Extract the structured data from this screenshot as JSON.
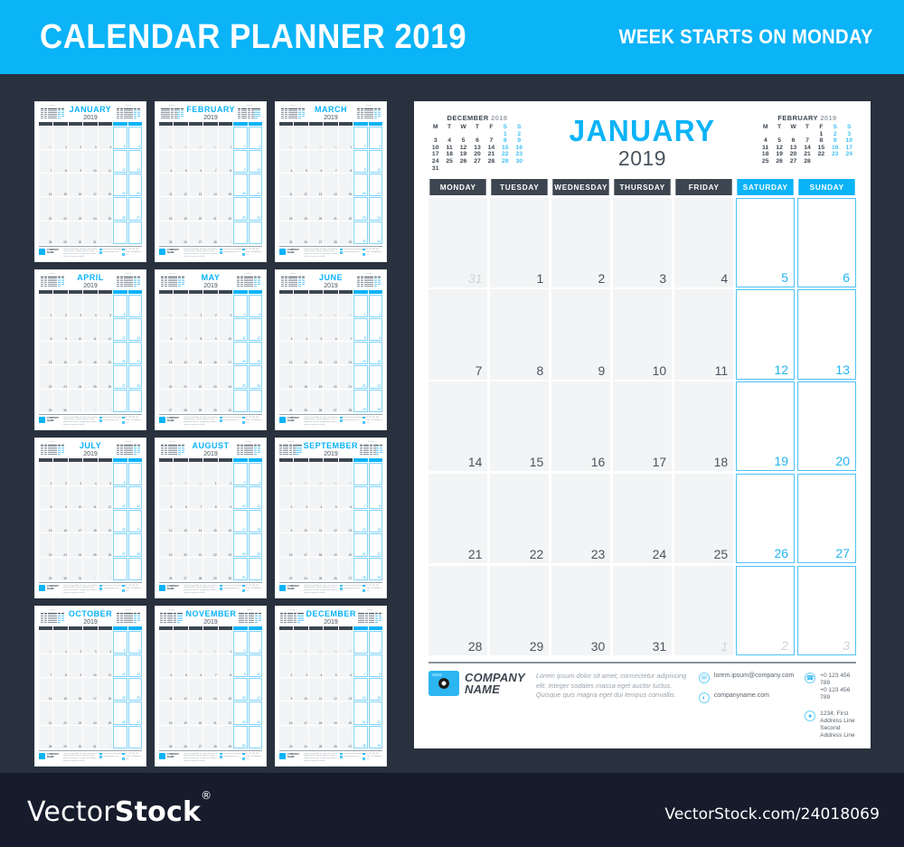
{
  "banner": {
    "title": "CALENDAR PLANNER 2019",
    "subtitle": "WEEK STARTS ON MONDAY"
  },
  "accent_colors": {
    "brand_blue": "#0bb3f7",
    "weekend_blue": "#4fc3f7",
    "dark_slate": "#3d4650",
    "artboard_dark": "#28313d",
    "watermark_bar": "#171c2c",
    "cell_gray": "#f3f4f5",
    "muted_text": "#9aa3ab"
  },
  "main_calendar": {
    "month": "JANUARY",
    "year": "2019",
    "weekday_headers": [
      {
        "label": "MONDAY",
        "weekend": false
      },
      {
        "label": "TUESDAY",
        "weekend": false
      },
      {
        "label": "WEDNESDAY",
        "weekend": false
      },
      {
        "label": "THURSDAY",
        "weekend": false
      },
      {
        "label": "FRIDAY",
        "weekend": false
      },
      {
        "label": "SATURDAY",
        "weekend": true
      },
      {
        "label": "SUNDAY",
        "weekend": true
      }
    ],
    "weeks": [
      [
        {
          "n": "31",
          "out": true
        },
        {
          "n": "1"
        },
        {
          "n": "2"
        },
        {
          "n": "3"
        },
        {
          "n": "4"
        },
        {
          "n": "5"
        },
        {
          "n": "6"
        }
      ],
      [
        {
          "n": "7"
        },
        {
          "n": "8"
        },
        {
          "n": "9"
        },
        {
          "n": "10"
        },
        {
          "n": "11"
        },
        {
          "n": "12"
        },
        {
          "n": "13"
        }
      ],
      [
        {
          "n": "14"
        },
        {
          "n": "15"
        },
        {
          "n": "16"
        },
        {
          "n": "17"
        },
        {
          "n": "18"
        },
        {
          "n": "19"
        },
        {
          "n": "20"
        }
      ],
      [
        {
          "n": "21"
        },
        {
          "n": "22"
        },
        {
          "n": "23"
        },
        {
          "n": "24"
        },
        {
          "n": "25"
        },
        {
          "n": "26"
        },
        {
          "n": "27"
        }
      ],
      [
        {
          "n": "28"
        },
        {
          "n": "29"
        },
        {
          "n": "30"
        },
        {
          "n": "31"
        },
        {
          "n": "1",
          "out": true
        },
        {
          "n": "2",
          "out": true
        },
        {
          "n": "3",
          "out": true
        }
      ]
    ],
    "prev_mini": {
      "month": "DECEMBER",
      "year": "2018",
      "weekday_initials": [
        "M",
        "T",
        "W",
        "T",
        "F",
        "S",
        "S"
      ],
      "weeks": [
        [
          "",
          "",
          "",
          "",
          "",
          "1",
          "2"
        ],
        [
          "3",
          "4",
          "5",
          "6",
          "7",
          "8",
          "9"
        ],
        [
          "10",
          "11",
          "12",
          "13",
          "14",
          "15",
          "16"
        ],
        [
          "17",
          "18",
          "19",
          "20",
          "21",
          "22",
          "23"
        ],
        [
          "24",
          "25",
          "26",
          "27",
          "28",
          "29",
          "30"
        ],
        [
          "31",
          "",
          "",
          "",
          "",
          "",
          ""
        ]
      ]
    },
    "next_mini": {
      "month": "FEBRUARY",
      "year": "2019",
      "weekday_initials": [
        "M",
        "T",
        "W",
        "T",
        "F",
        "S",
        "S"
      ],
      "weeks": [
        [
          "",
          "",
          "",
          "",
          "1",
          "2",
          "3"
        ],
        [
          "4",
          "5",
          "6",
          "7",
          "8",
          "9",
          "10"
        ],
        [
          "11",
          "12",
          "13",
          "14",
          "15",
          "16",
          "17"
        ],
        [
          "18",
          "19",
          "20",
          "21",
          "22",
          "23",
          "24"
        ],
        [
          "25",
          "26",
          "27",
          "28",
          "",
          "",
          ""
        ]
      ]
    }
  },
  "footer": {
    "company_name_line1": "COMPANY",
    "company_name_line2": "NAME",
    "lorem": "Lorem ipsum dolor sit amet, consectetur adipiscing elit. Integer sodales massa eget auctor luctus. Quisque quis magna eget dui tempus convallis.",
    "email": "lorem.ipsum@company.com",
    "website": "companyname.com",
    "phone_line1": "+0 123 456 789",
    "phone_line2": "+0 123 456 789",
    "address_line1": "1234, First Address Line",
    "address_line2": "Second Address Line",
    "icons": {
      "email": "envelope-icon",
      "web": "globe-icon",
      "phone": "phone-icon",
      "location": "map-pin-icon"
    }
  },
  "thumbnails": [
    {
      "month": "JANUARY",
      "year": "2019",
      "lead_out": 1,
      "days": 31,
      "trail_out": 3
    },
    {
      "month": "FEBRUARY",
      "year": "2019",
      "lead_out": 4,
      "days": 28,
      "trail_out": 3
    },
    {
      "month": "MARCH",
      "year": "2019",
      "lead_out": 4,
      "days": 31,
      "trail_out": 0
    },
    {
      "month": "APRIL",
      "year": "2019",
      "lead_out": 0,
      "days": 30,
      "trail_out": 5
    },
    {
      "month": "MAY",
      "year": "2019",
      "lead_out": 2,
      "days": 31,
      "trail_out": 2
    },
    {
      "month": "JUNE",
      "year": "2019",
      "lead_out": 5,
      "days": 30,
      "trail_out": 0
    },
    {
      "month": "JULY",
      "year": "2019",
      "lead_out": 0,
      "days": 31,
      "trail_out": 4
    },
    {
      "month": "AUGUST",
      "year": "2019",
      "lead_out": 3,
      "days": 31,
      "trail_out": 1
    },
    {
      "month": "SEPTEMBER",
      "year": "2019",
      "lead_out": 6,
      "days": 30,
      "trail_out": 4
    },
    {
      "month": "OCTOBER",
      "year": "2019",
      "lead_out": 1,
      "days": 31,
      "trail_out": 3
    },
    {
      "month": "NOVEMBER",
      "year": "2019",
      "lead_out": 4,
      "days": 30,
      "trail_out": 1
    },
    {
      "month": "DECEMBER",
      "year": "2019",
      "lead_out": 6,
      "days": 31,
      "trail_out": 5
    }
  ],
  "thumbnail_weekday_initials": [
    "MONDAY",
    "TUESDAY",
    "WEDNESDAY",
    "THURSDAY",
    "FRIDAY",
    "SATURDAY",
    "SUNDAY"
  ],
  "watermark": {
    "brand_light": "Vector",
    "brand_bold": "Stock",
    "registered": "®",
    "url": "VectorStock.com/24018069"
  }
}
